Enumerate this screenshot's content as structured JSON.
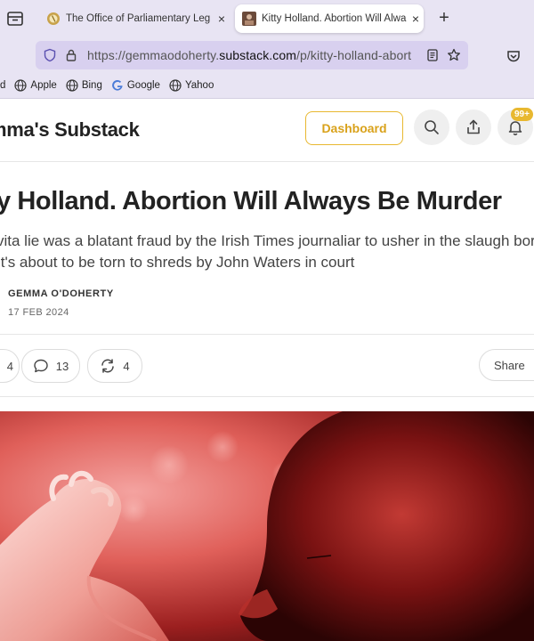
{
  "browser": {
    "tabs": [
      {
        "title": "The Office of Parliamentary Leg",
        "active": false
      },
      {
        "title": "Kitty Holland. Abortion Will Alwa",
        "active": true
      }
    ],
    "new_tab_label": "+",
    "close_label": "×",
    "url": {
      "prefix": "https://gemmaodoherty.",
      "domain": "substack.com",
      "path": "/p/kitty-holland-abort"
    },
    "bookmarks": [
      {
        "label": "d",
        "icon": "partial-bookmark"
      },
      {
        "label": "Apple",
        "icon": "globe-icon"
      },
      {
        "label": "Bing",
        "icon": "globe-icon"
      },
      {
        "label": "Google",
        "icon": "google-icon"
      },
      {
        "label": "Yahoo",
        "icon": "globe-icon"
      }
    ]
  },
  "site": {
    "name": "mma's Substack",
    "dashboard_label": "Dashboard",
    "notification_count": "99+"
  },
  "article": {
    "title": "y Holland. Abortion Will Always Be Murder",
    "subtitle": "vita lie was a blatant fraud by the Irish Times journaliar to usher in the slaugh born. It's about to be torn to shreds by John Waters in court",
    "author": "GEMMA O'DOHERTY",
    "date": "17 FEB 2024",
    "likes_count": "4",
    "comments_count": "13",
    "restacks_count": "4",
    "share_label": "Share"
  },
  "colors": {
    "accent": "#e8b830",
    "chrome": "#e8e4f3",
    "urlbar": "#d8d0ef"
  }
}
